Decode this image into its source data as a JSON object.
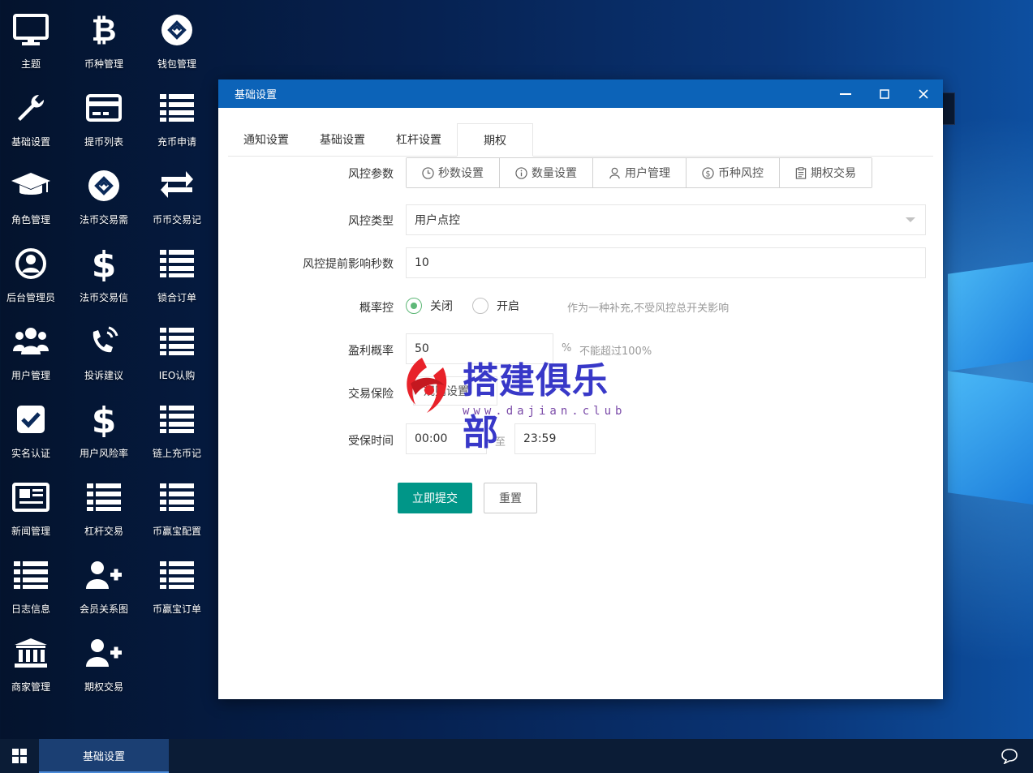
{
  "desktop_icons": [
    {
      "label": "主题",
      "icon": "monitor-icon"
    },
    {
      "label": "币种管理",
      "icon": "bitcoin-icon"
    },
    {
      "label": "钱包管理",
      "icon": "wallet-logo-icon"
    },
    {
      "label": "基础设置",
      "icon": "wrench-icon"
    },
    {
      "label": "提币列表",
      "icon": "credit-card-icon"
    },
    {
      "label": "充币申请",
      "icon": "list-icon"
    },
    {
      "label": "角色管理",
      "icon": "graduation-cap-icon"
    },
    {
      "label": "法币交易需",
      "icon": "exchange-logo-icon"
    },
    {
      "label": "币币交易记",
      "icon": "swap-arrows-icon"
    },
    {
      "label": "后台管理员",
      "icon": "user-circle-icon"
    },
    {
      "label": "法币交易信",
      "icon": "dollar-icon"
    },
    {
      "label": "锁合订单",
      "icon": "list-icon"
    },
    {
      "label": "用户管理",
      "icon": "users-icon"
    },
    {
      "label": "投诉建议",
      "icon": "phone-volume-icon"
    },
    {
      "label": "IEO认购",
      "icon": "list-icon"
    },
    {
      "label": "实名认证",
      "icon": "check-square-icon"
    },
    {
      "label": "用户风险率",
      "icon": "dollar-icon"
    },
    {
      "label": "链上充币记",
      "icon": "list-icon"
    },
    {
      "label": "新闻管理",
      "icon": "newspaper-icon"
    },
    {
      "label": "杠杆交易",
      "icon": "list-icon"
    },
    {
      "label": "币赢宝配置",
      "icon": "list-icon"
    },
    {
      "label": "日志信息",
      "icon": "list-icon"
    },
    {
      "label": "会员关系图",
      "icon": "user-plus-icon"
    },
    {
      "label": "币赢宝订单",
      "icon": "list-icon"
    },
    {
      "label": "商家管理",
      "icon": "bank-icon"
    },
    {
      "label": "期权交易",
      "icon": "user-plus-icon"
    }
  ],
  "dialog": {
    "title": "基础设置",
    "tabs": [
      "通知设置",
      "基础设置",
      "杠杆设置",
      "期权"
    ],
    "active_tab": "期权",
    "form": {
      "risk_params_label": "风控参数",
      "risk_buttons": [
        {
          "label": "秒数设置",
          "icon": "clock-icon"
        },
        {
          "label": "数量设置",
          "icon": "info-icon"
        },
        {
          "label": "用户管理",
          "icon": "user-icon"
        },
        {
          "label": "币种风控",
          "icon": "dollar-circle-icon"
        },
        {
          "label": "期权交易",
          "icon": "clipboard-icon"
        }
      ],
      "risk_type_label": "风控类型",
      "risk_type_value": "用户点控",
      "advance_seconds_label": "风控提前影响秒数",
      "advance_seconds_value": "10",
      "probability_label": "概率控",
      "radio_off": "关闭",
      "radio_on": "开启",
      "probability_selected": "关闭",
      "probability_hint": "作为一种补充,不受风控总开关影响",
      "profit_label": "盈利概率",
      "profit_value": "50",
      "profit_unit": "%",
      "profit_hint": "不能超过100%",
      "insurance_label": "交易保险",
      "insurance_button": "规则设置",
      "insured_time_label": "受保时间",
      "time_start": "00:00",
      "time_to": "至",
      "time_end": "23:59",
      "submit": "立即提交",
      "reset": "重置"
    }
  },
  "watermark": {
    "title": "搭建俱乐部",
    "url": "www.dajian.club"
  },
  "taskbar": {
    "active_item": "基础设置"
  },
  "colors": {
    "titlebar": "#0c63b8",
    "primary": "#009688",
    "radio_on": "#5fb878",
    "taskbar": "#0b1c36"
  }
}
